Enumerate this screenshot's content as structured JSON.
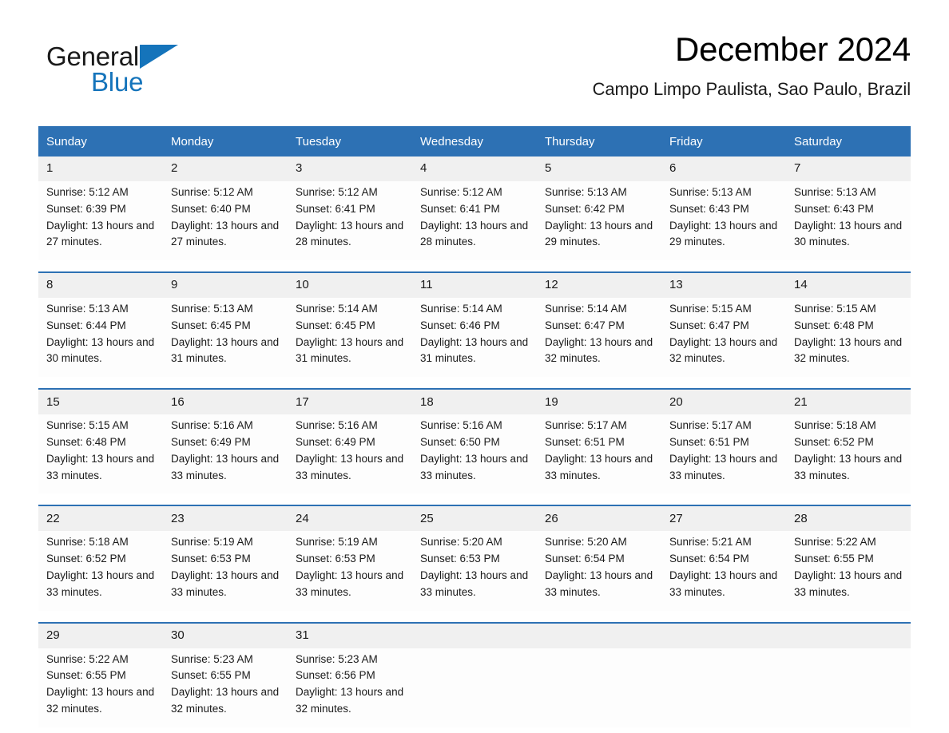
{
  "brand": {
    "name_part1": "General",
    "name_part2": "Blue",
    "triangle_color": "#1574bb",
    "logo_icon": "triangle-logo-icon"
  },
  "header": {
    "month_title": "December 2024",
    "location": "Campo Limpo Paulista, Sao Paulo, Brazil"
  },
  "theme": {
    "header_blue": "#2d71b4",
    "row_separator_blue": "#2d71b4",
    "daynum_band_gray": "#f0f0f0",
    "brand_blue": "#1574bb"
  },
  "calendar": {
    "weekday_headers": [
      "Sunday",
      "Monday",
      "Tuesday",
      "Wednesday",
      "Thursday",
      "Friday",
      "Saturday"
    ],
    "weeks": [
      [
        {
          "day": "1",
          "sunrise": "Sunrise: 5:12 AM",
          "sunset": "Sunset: 6:39 PM",
          "daylight": "Daylight: 13 hours and 27 minutes."
        },
        {
          "day": "2",
          "sunrise": "Sunrise: 5:12 AM",
          "sunset": "Sunset: 6:40 PM",
          "daylight": "Daylight: 13 hours and 27 minutes."
        },
        {
          "day": "3",
          "sunrise": "Sunrise: 5:12 AM",
          "sunset": "Sunset: 6:41 PM",
          "daylight": "Daylight: 13 hours and 28 minutes."
        },
        {
          "day": "4",
          "sunrise": "Sunrise: 5:12 AM",
          "sunset": "Sunset: 6:41 PM",
          "daylight": "Daylight: 13 hours and 28 minutes."
        },
        {
          "day": "5",
          "sunrise": "Sunrise: 5:13 AM",
          "sunset": "Sunset: 6:42 PM",
          "daylight": "Daylight: 13 hours and 29 minutes."
        },
        {
          "day": "6",
          "sunrise": "Sunrise: 5:13 AM",
          "sunset": "Sunset: 6:43 PM",
          "daylight": "Daylight: 13 hours and 29 minutes."
        },
        {
          "day": "7",
          "sunrise": "Sunrise: 5:13 AM",
          "sunset": "Sunset: 6:43 PM",
          "daylight": "Daylight: 13 hours and 30 minutes."
        }
      ],
      [
        {
          "day": "8",
          "sunrise": "Sunrise: 5:13 AM",
          "sunset": "Sunset: 6:44 PM",
          "daylight": "Daylight: 13 hours and 30 minutes."
        },
        {
          "day": "9",
          "sunrise": "Sunrise: 5:13 AM",
          "sunset": "Sunset: 6:45 PM",
          "daylight": "Daylight: 13 hours and 31 minutes."
        },
        {
          "day": "10",
          "sunrise": "Sunrise: 5:14 AM",
          "sunset": "Sunset: 6:45 PM",
          "daylight": "Daylight: 13 hours and 31 minutes."
        },
        {
          "day": "11",
          "sunrise": "Sunrise: 5:14 AM",
          "sunset": "Sunset: 6:46 PM",
          "daylight": "Daylight: 13 hours and 31 minutes."
        },
        {
          "day": "12",
          "sunrise": "Sunrise: 5:14 AM",
          "sunset": "Sunset: 6:47 PM",
          "daylight": "Daylight: 13 hours and 32 minutes."
        },
        {
          "day": "13",
          "sunrise": "Sunrise: 5:15 AM",
          "sunset": "Sunset: 6:47 PM",
          "daylight": "Daylight: 13 hours and 32 minutes."
        },
        {
          "day": "14",
          "sunrise": "Sunrise: 5:15 AM",
          "sunset": "Sunset: 6:48 PM",
          "daylight": "Daylight: 13 hours and 32 minutes."
        }
      ],
      [
        {
          "day": "15",
          "sunrise": "Sunrise: 5:15 AM",
          "sunset": "Sunset: 6:48 PM",
          "daylight": "Daylight: 13 hours and 33 minutes."
        },
        {
          "day": "16",
          "sunrise": "Sunrise: 5:16 AM",
          "sunset": "Sunset: 6:49 PM",
          "daylight": "Daylight: 13 hours and 33 minutes."
        },
        {
          "day": "17",
          "sunrise": "Sunrise: 5:16 AM",
          "sunset": "Sunset: 6:49 PM",
          "daylight": "Daylight: 13 hours and 33 minutes."
        },
        {
          "day": "18",
          "sunrise": "Sunrise: 5:16 AM",
          "sunset": "Sunset: 6:50 PM",
          "daylight": "Daylight: 13 hours and 33 minutes."
        },
        {
          "day": "19",
          "sunrise": "Sunrise: 5:17 AM",
          "sunset": "Sunset: 6:51 PM",
          "daylight": "Daylight: 13 hours and 33 minutes."
        },
        {
          "day": "20",
          "sunrise": "Sunrise: 5:17 AM",
          "sunset": "Sunset: 6:51 PM",
          "daylight": "Daylight: 13 hours and 33 minutes."
        },
        {
          "day": "21",
          "sunrise": "Sunrise: 5:18 AM",
          "sunset": "Sunset: 6:52 PM",
          "daylight": "Daylight: 13 hours and 33 minutes."
        }
      ],
      [
        {
          "day": "22",
          "sunrise": "Sunrise: 5:18 AM",
          "sunset": "Sunset: 6:52 PM",
          "daylight": "Daylight: 13 hours and 33 minutes."
        },
        {
          "day": "23",
          "sunrise": "Sunrise: 5:19 AM",
          "sunset": "Sunset: 6:53 PM",
          "daylight": "Daylight: 13 hours and 33 minutes."
        },
        {
          "day": "24",
          "sunrise": "Sunrise: 5:19 AM",
          "sunset": "Sunset: 6:53 PM",
          "daylight": "Daylight: 13 hours and 33 minutes."
        },
        {
          "day": "25",
          "sunrise": "Sunrise: 5:20 AM",
          "sunset": "Sunset: 6:53 PM",
          "daylight": "Daylight: 13 hours and 33 minutes."
        },
        {
          "day": "26",
          "sunrise": "Sunrise: 5:20 AM",
          "sunset": "Sunset: 6:54 PM",
          "daylight": "Daylight: 13 hours and 33 minutes."
        },
        {
          "day": "27",
          "sunrise": "Sunrise: 5:21 AM",
          "sunset": "Sunset: 6:54 PM",
          "daylight": "Daylight: 13 hours and 33 minutes."
        },
        {
          "day": "28",
          "sunrise": "Sunrise: 5:22 AM",
          "sunset": "Sunset: 6:55 PM",
          "daylight": "Daylight: 13 hours and 33 minutes."
        }
      ],
      [
        {
          "day": "29",
          "sunrise": "Sunrise: 5:22 AM",
          "sunset": "Sunset: 6:55 PM",
          "daylight": "Daylight: 13 hours and 32 minutes."
        },
        {
          "day": "30",
          "sunrise": "Sunrise: 5:23 AM",
          "sunset": "Sunset: 6:55 PM",
          "daylight": "Daylight: 13 hours and 32 minutes."
        },
        {
          "day": "31",
          "sunrise": "Sunrise: 5:23 AM",
          "sunset": "Sunset: 6:56 PM",
          "daylight": "Daylight: 13 hours and 32 minutes."
        },
        {
          "day": "",
          "sunrise": "",
          "sunset": "",
          "daylight": ""
        },
        {
          "day": "",
          "sunrise": "",
          "sunset": "",
          "daylight": ""
        },
        {
          "day": "",
          "sunrise": "",
          "sunset": "",
          "daylight": ""
        },
        {
          "day": "",
          "sunrise": "",
          "sunset": "",
          "daylight": ""
        }
      ]
    ]
  }
}
